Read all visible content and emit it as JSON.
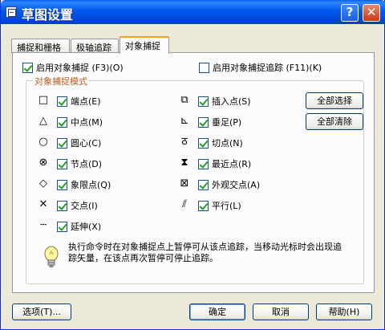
{
  "window": {
    "title": "草图设置"
  },
  "titlebar_buttons": {
    "help": "?",
    "close": "✕"
  },
  "tabs": [
    {
      "label": "捕捉和栅格",
      "active": false
    },
    {
      "label": "极轴追踪",
      "active": false
    },
    {
      "label": "对象捕捉",
      "active": true
    }
  ],
  "top_options": {
    "enable_osnap": {
      "label": "启用对象捕捉 (F3)(O)",
      "checked": true
    },
    "enable_tracking": {
      "label": "启用对象捕捉追踪 (F11)(K)",
      "checked": false
    }
  },
  "group": {
    "label": "对象捕捉模式"
  },
  "snap_modes_left": [
    {
      "symbol": "square",
      "glyph": "□",
      "label": "端点(E)",
      "checked": true
    },
    {
      "symbol": "triangle",
      "glyph": "△",
      "label": "中点(M)",
      "checked": true
    },
    {
      "symbol": "circle",
      "glyph": "○",
      "label": "圆心(C)",
      "checked": true
    },
    {
      "symbol": "circle-x",
      "glyph": "⊗",
      "label": "节点(D)",
      "checked": true
    },
    {
      "symbol": "diamond",
      "glyph": "◇",
      "label": "象限点(Q)",
      "checked": true
    },
    {
      "symbol": "x-mark",
      "glyph": "✕",
      "label": "交点(I)",
      "checked": true
    },
    {
      "symbol": "extension",
      "glyph": "┄",
      "label": "延伸(X)",
      "checked": true
    }
  ],
  "snap_modes_right": [
    {
      "symbol": "insert",
      "glyph": "⧉",
      "label": "插入点(S)",
      "checked": true
    },
    {
      "symbol": "perpendicular",
      "glyph": "⊾",
      "label": "垂足(P)",
      "checked": true
    },
    {
      "symbol": "tangent",
      "glyph": "ठ",
      "label": "切点(N)",
      "checked": true
    },
    {
      "symbol": "nearest",
      "glyph": "⧗",
      "label": "最近点(R)",
      "checked": true
    },
    {
      "symbol": "apparent-intersection",
      "glyph": "⊠",
      "label": "外观交点(A)",
      "checked": true
    },
    {
      "symbol": "parallel",
      "glyph": "⫽",
      "label": "平行(L)",
      "checked": true
    }
  ],
  "side_buttons": {
    "select_all": "全部选择",
    "clear_all": "全部清除"
  },
  "note": "执行命令时在对象捕捉点上暂停可从该点追踪，当移动光标时会出现追踪矢量，在该点再次暂停可停止追踪。",
  "footer": {
    "options": "选项(T)...",
    "ok": "确定",
    "cancel": "取消",
    "help": "帮助(H)"
  }
}
